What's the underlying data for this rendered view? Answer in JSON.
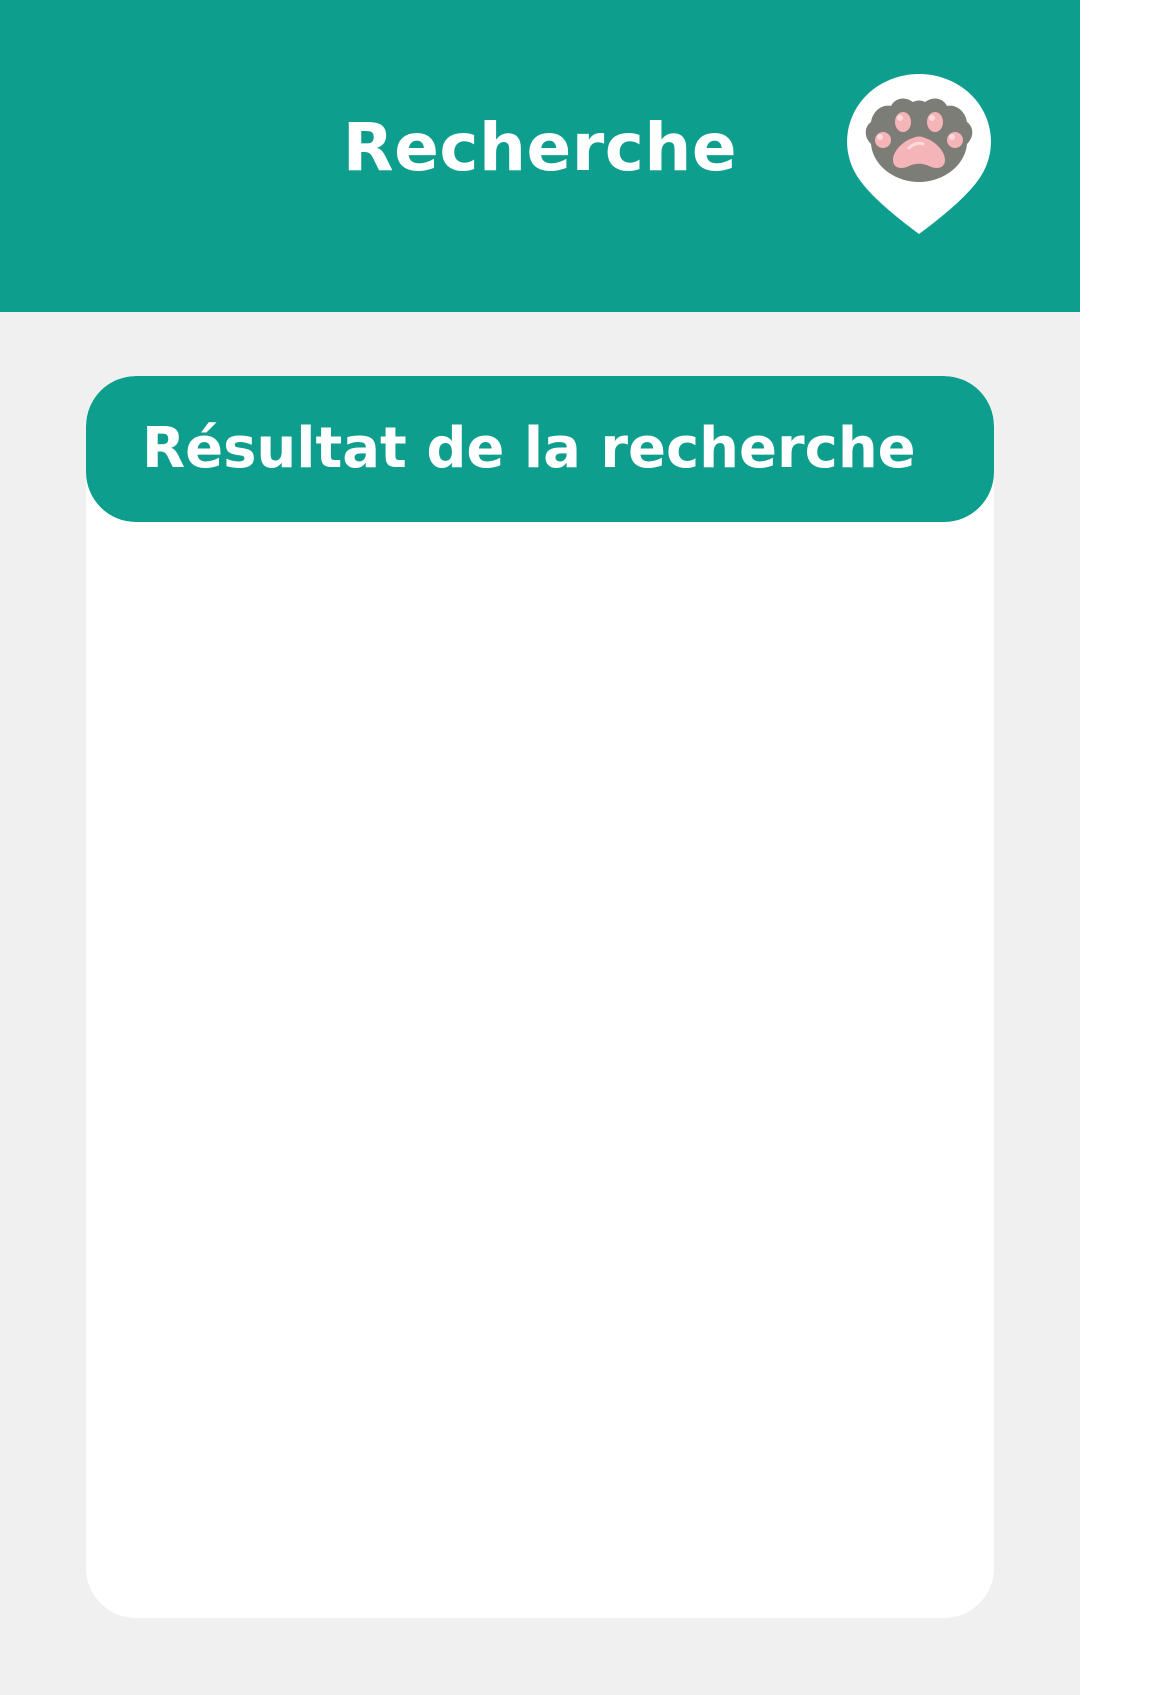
{
  "header": {
    "title": "Recherche",
    "logo_icon": "paw-pin-icon"
  },
  "results_card": {
    "title": "Résultat de la recherche",
    "items": []
  },
  "colors": {
    "primary": "#0e9e8e",
    "background": "#f0f0f0",
    "card": "#ffffff",
    "paw": "#7d7d78",
    "paw_pads": "#f5b5b8"
  }
}
